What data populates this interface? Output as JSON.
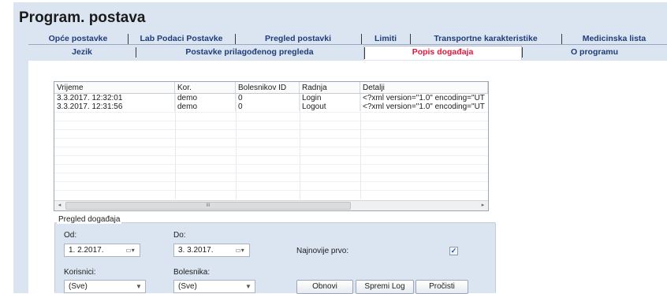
{
  "window": {
    "title": "Program. postava"
  },
  "tabs_row1": [
    {
      "label": "Opće postavke"
    },
    {
      "label": "Lab Podaci Postavke"
    },
    {
      "label": "Pregled postavki"
    },
    {
      "label": "Limiti"
    },
    {
      "label": "Transportne karakteristike"
    },
    {
      "label": "Medicinska lista"
    }
  ],
  "tabs_row2": [
    {
      "label": "Jezik"
    },
    {
      "label": "Postavke prilagođenog pregleda"
    },
    {
      "label": "Popis događaja",
      "active": true
    },
    {
      "label": "O programu"
    }
  ],
  "log_table": {
    "columns": [
      "Vrijeme",
      "Kor.",
      "Bolesnikov ID",
      "Radnja",
      "Detalji"
    ],
    "rows": [
      [
        "3.3.2017. 12:32:01",
        "demo",
        "0",
        "Login",
        "<?xml version=\"1.0\" encoding=\"UT"
      ],
      [
        "3.3.2017. 12:31:56",
        "demo",
        "0",
        "Logout",
        "<?xml version=\"1.0\" encoding=\"UT"
      ]
    ],
    "scrollbar_thumb_glyph": "III"
  },
  "event_review": {
    "group_title": "Pregled događaja",
    "from_label": "Od:",
    "from_value": "1. 2.2017.",
    "to_label": "Do:",
    "to_value": "3. 3.2017.",
    "newest_first_label": "Najnovije prvo:",
    "newest_first_checked": true,
    "users_label": "Korisnici:",
    "users_value": "(Sve)",
    "patients_label": "Bolesnika:",
    "patients_value": "(Sve)",
    "refresh_label": "Obnovi",
    "save_log_label": "Spremi Log",
    "clear_label": "Pročisti"
  },
  "colors": {
    "page_bg": "#dbe5f1",
    "tab_text": "#1e3c78",
    "active_tab_text": "#e4143c"
  }
}
